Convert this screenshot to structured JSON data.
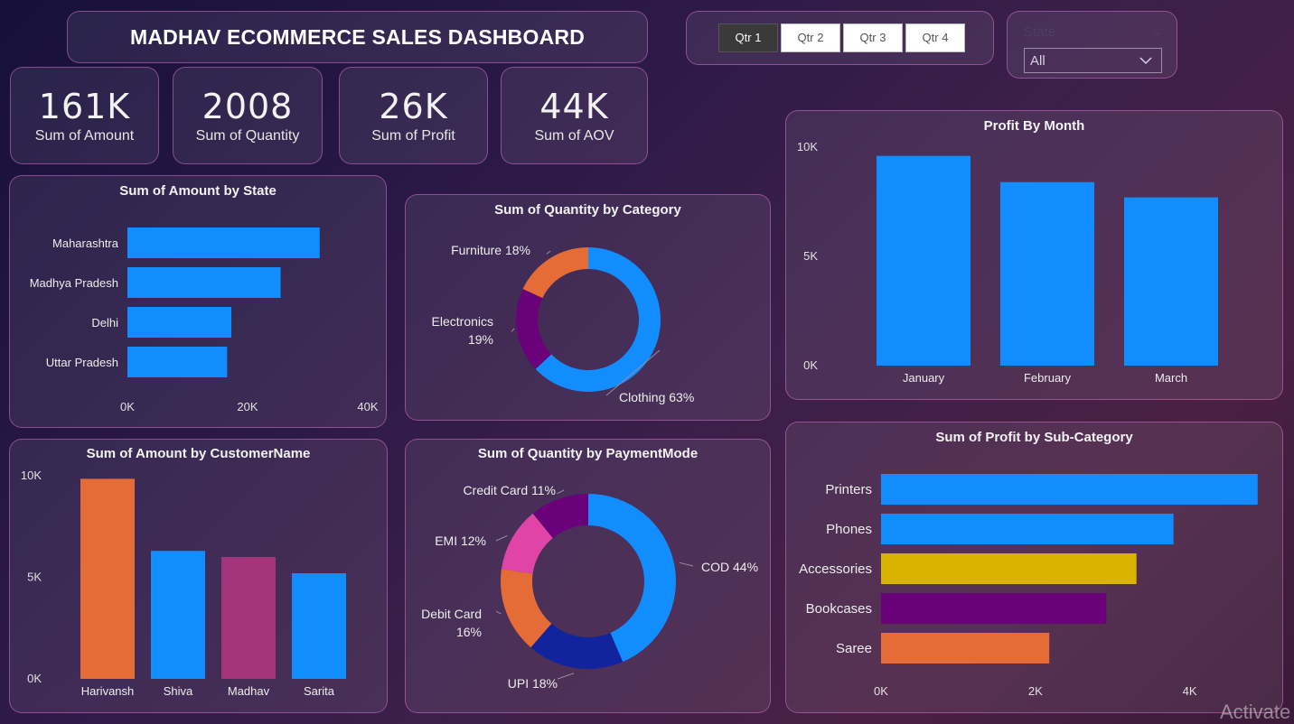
{
  "header": {
    "title": "MADHAV ECOMMERCE SALES DASHBOARD"
  },
  "kpis": [
    {
      "value": "161K",
      "label": "Sum of Amount"
    },
    {
      "value": "2008",
      "label": "Sum of Quantity"
    },
    {
      "value": "26K",
      "label": "Sum of Profit"
    },
    {
      "value": "44K",
      "label": "Sum of AOV"
    }
  ],
  "quarter_slicer": {
    "buttons": [
      "Qtr 1",
      "Qtr 2",
      "Qtr 3",
      "Qtr 4"
    ],
    "selected": "Qtr 1"
  },
  "state_slicer": {
    "title": "State",
    "value": "All"
  },
  "watermark": "Activate",
  "colors": {
    "blue": "#118dff",
    "orange": "#e66c37",
    "purple": "#6b007b",
    "magenta": "#a3347c",
    "pink": "#e044a7",
    "navy": "#12239e",
    "gold": "#d9b300"
  },
  "chart_data": [
    {
      "type": "bar",
      "orientation": "horizontal",
      "title": "Sum of Amount by State",
      "categories": [
        "Maharashtra",
        "Madhya Pradesh",
        "Delhi",
        "Uttar Pradesh"
      ],
      "values": [
        32000,
        25500,
        17300,
        16600
      ],
      "xlim": [
        0,
        40000
      ],
      "ticks": [
        {
          "value": 0,
          "label": "0K"
        },
        {
          "value": 20000,
          "label": "20K"
        },
        {
          "value": 40000,
          "label": "40K"
        }
      ],
      "colors": [
        "#118dff",
        "#118dff",
        "#118dff",
        "#118dff"
      ]
    },
    {
      "type": "pie",
      "title": "Sum of Quantity by Category",
      "slices": [
        {
          "name": "Clothing",
          "value": 63,
          "label": "Clothing 63%",
          "color": "#118dff"
        },
        {
          "name": "Electronics",
          "value": 19,
          "label": "Electronics 19%",
          "color": "#6b007b"
        },
        {
          "name": "Furniture",
          "value": 18,
          "label": "Furniture 18%",
          "color": "#e66c37"
        }
      ]
    },
    {
      "type": "bar",
      "title": "Profit By Month",
      "categories": [
        "January",
        "February",
        "March"
      ],
      "values": [
        9600,
        8400,
        7700
      ],
      "ylim": [
        0,
        10000
      ],
      "ticks": [
        {
          "value": 0,
          "label": "0K"
        },
        {
          "value": 5000,
          "label": "5K"
        },
        {
          "value": 10000,
          "label": "10K"
        }
      ],
      "colors": [
        "#118dff",
        "#118dff",
        "#118dff"
      ]
    },
    {
      "type": "bar",
      "title": "Sum of Amount by CustomerName",
      "categories": [
        "Harivansh",
        "Shiva",
        "Madhav",
        "Sarita"
      ],
      "values": [
        9850,
        6300,
        6000,
        5200
      ],
      "ylim": [
        0,
        10000
      ],
      "ticks": [
        {
          "value": 0,
          "label": "0K"
        },
        {
          "value": 5000,
          "label": "5K"
        },
        {
          "value": 10000,
          "label": "10K"
        }
      ],
      "colors": [
        "#e66c37",
        "#118dff",
        "#a3347c",
        "#118dff"
      ]
    },
    {
      "type": "pie",
      "title": "Sum of Quantity by PaymentMode",
      "slices": [
        {
          "name": "COD",
          "value": 44,
          "label": "COD 44%",
          "color": "#118dff"
        },
        {
          "name": "UPI",
          "value": 18,
          "label": "UPI 18%",
          "color": "#12239e"
        },
        {
          "name": "Debit Card",
          "value": 16,
          "label": "Debit Card 16%",
          "color": "#e66c37"
        },
        {
          "name": "EMI",
          "value": 12,
          "label": "EMI 12%",
          "color": "#e044a7"
        },
        {
          "name": "Credit Card",
          "value": 11,
          "label": "Credit Card 11%",
          "color": "#6b007b"
        }
      ]
    },
    {
      "type": "bar",
      "orientation": "horizontal",
      "title": "Sum of Profit by Sub-Category",
      "categories": [
        "Printers",
        "Phones",
        "Accessories",
        "Bookcases",
        "Saree"
      ],
      "values": [
        4880,
        3790,
        3310,
        2920,
        2180
      ],
      "xlim": [
        0,
        5000
      ],
      "ticks": [
        {
          "value": 0,
          "label": "0K"
        },
        {
          "value": 2000,
          "label": "2K"
        },
        {
          "value": 4000,
          "label": "4K"
        }
      ],
      "colors": [
        "#118dff",
        "#118dff",
        "#d9b300",
        "#6b007b",
        "#e66c37"
      ]
    }
  ]
}
